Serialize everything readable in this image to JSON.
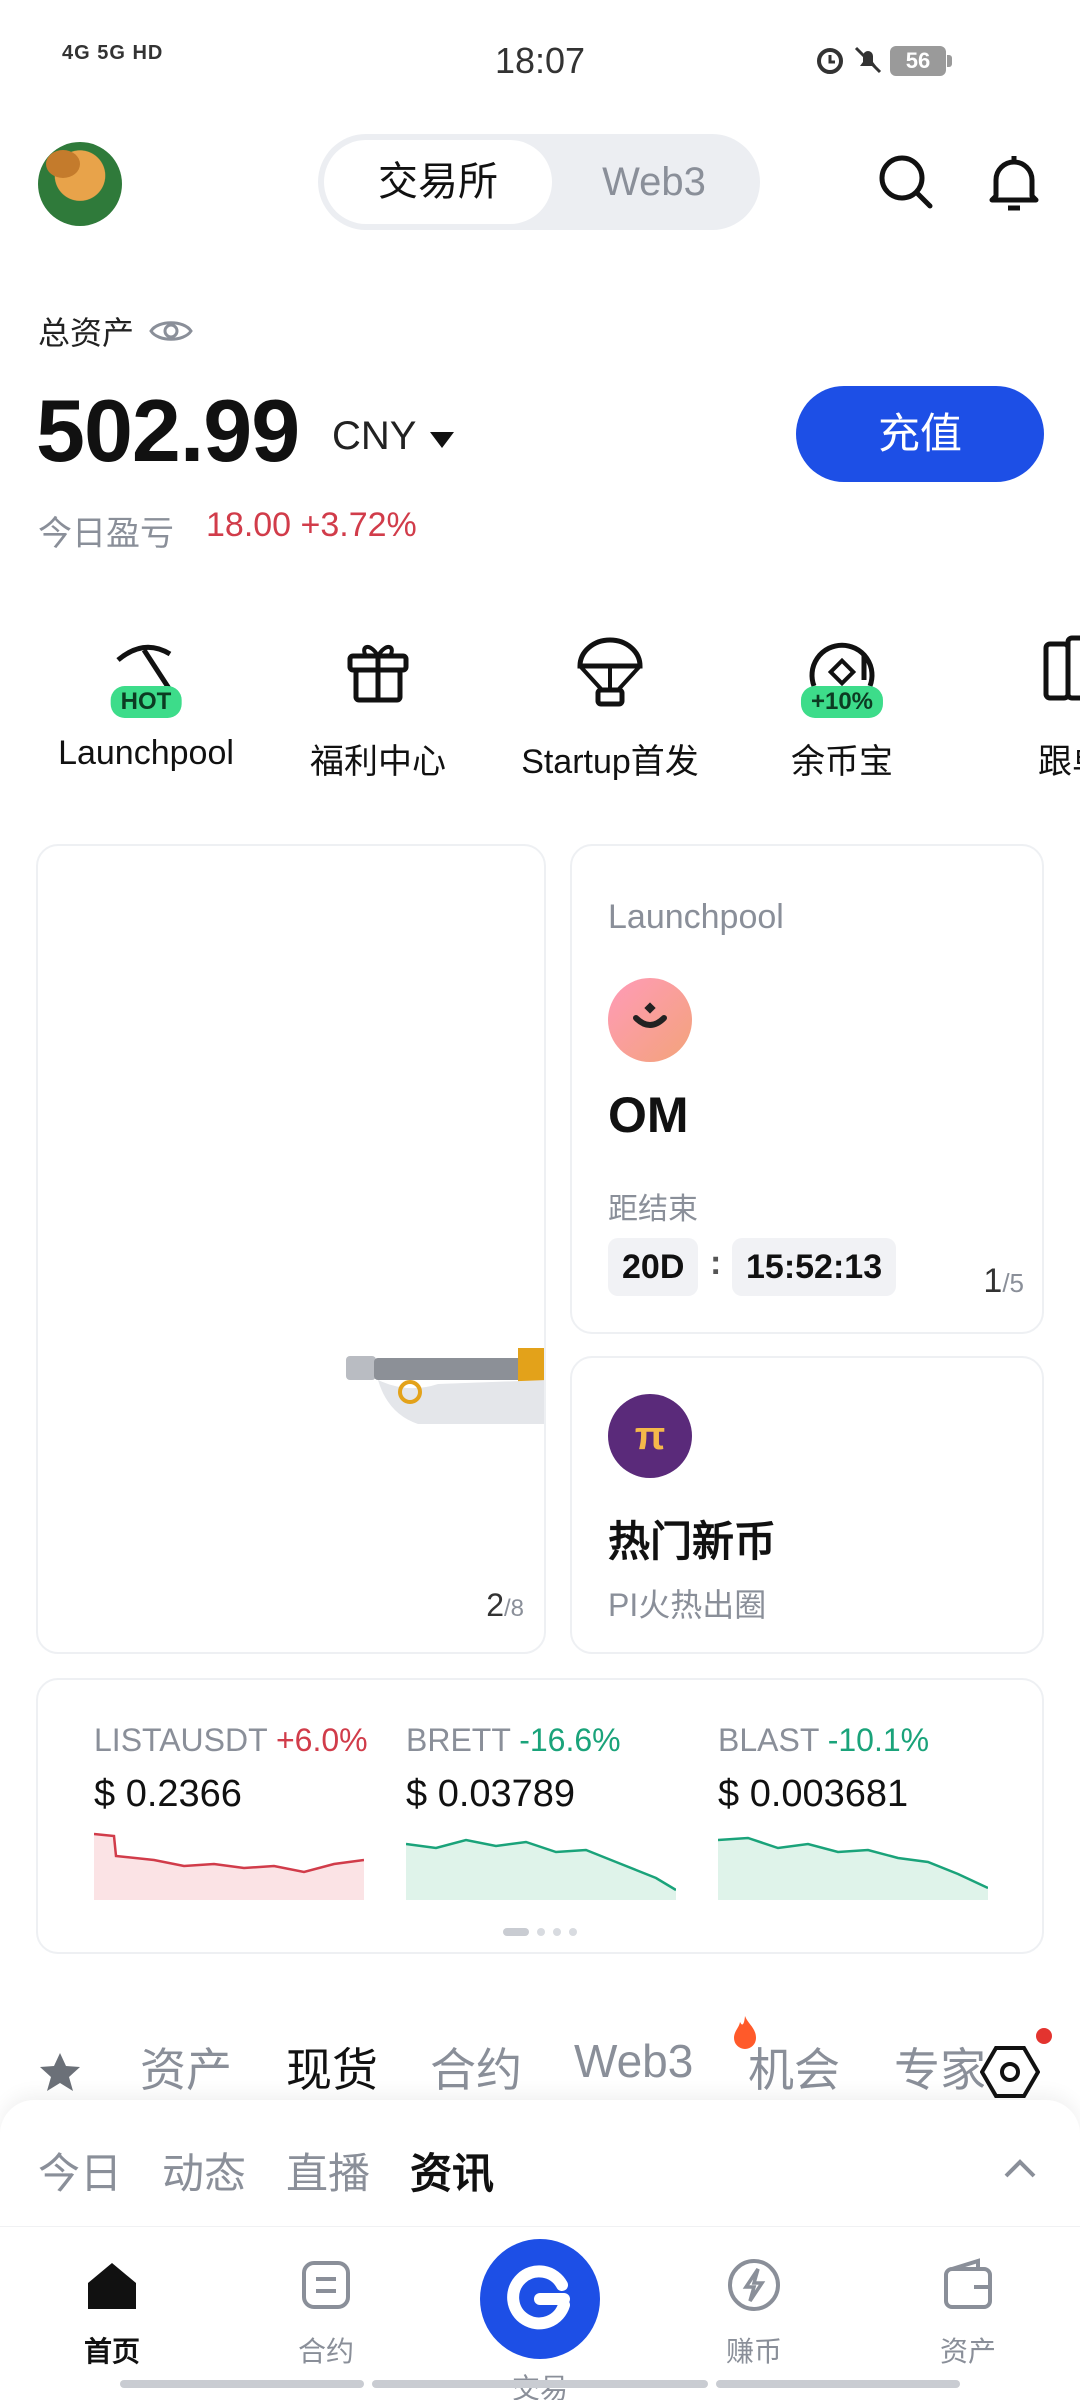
{
  "status_bar": {
    "signal": "4G 5G HD",
    "time": "18:07",
    "battery": "56"
  },
  "header": {
    "tabs": [
      {
        "label": "交易所",
        "active": true
      },
      {
        "label": "Web3",
        "active": false
      }
    ],
    "icons": [
      "search-icon",
      "bell-icon"
    ]
  },
  "assets": {
    "label": "总资产",
    "amount": "502.99",
    "currency": "CNY",
    "deposit_label": "充值",
    "pnl_label": "今日盈亏",
    "pnl_value": "18.00 +3.72%"
  },
  "shortcuts": [
    {
      "label": "Launchpool",
      "icon": "pickaxe-icon",
      "badge": "HOT"
    },
    {
      "label": "福利中心",
      "icon": "gift-icon",
      "badge": ""
    },
    {
      "label": "Startup首发",
      "icon": "parachute-icon",
      "badge": ""
    },
    {
      "label": "余币宝",
      "icon": "savings-icon",
      "badge": "+10%"
    },
    {
      "label": "跟单",
      "icon": "copy-trade-icon",
      "badge": ""
    }
  ],
  "banner": {
    "page": "2",
    "total": "/8"
  },
  "launchpool_card": {
    "title": "Launchpool",
    "coin": "OM",
    "ends_label": "距结束",
    "days": "20D",
    "time": "15:52:13",
    "page": "1",
    "total": "/5"
  },
  "hot_card": {
    "title": "热门新币",
    "subtitle": "PI火热出圈",
    "logo": "π"
  },
  "tickers": [
    {
      "symbol": "LISTAUSDT",
      "change": "+6.0%",
      "direction": "up",
      "price": "$ 0.2366",
      "color": "#d13c4a"
    },
    {
      "symbol": "BRETT",
      "change": "-16.6%",
      "direction": "down",
      "price": "$ 0.03789",
      "color": "#1aa37a"
    },
    {
      "symbol": "BLAST",
      "change": "-10.1%",
      "direction": "down",
      "price": "$ 0.003681",
      "color": "#1aa37a"
    }
  ],
  "market_tabs": [
    {
      "label": "资产",
      "active": false
    },
    {
      "label": "现货",
      "active": true
    },
    {
      "label": "合约",
      "active": false
    },
    {
      "label": "Web3",
      "active": false
    },
    {
      "label": "机会",
      "active": false
    },
    {
      "label": "专家",
      "active": false
    }
  ],
  "news_tabs": [
    {
      "label": "今日",
      "active": false
    },
    {
      "label": "动态",
      "active": false
    },
    {
      "label": "直播",
      "active": false
    },
    {
      "label": "资讯",
      "active": true
    }
  ],
  "bottom_nav": [
    {
      "label": "首页",
      "icon": "home-icon",
      "active": true
    },
    {
      "label": "合约",
      "icon": "contract-icon",
      "active": false
    },
    {
      "label": "交易",
      "icon": "trade-icon",
      "active": false
    },
    {
      "label": "赚币",
      "icon": "earn-icon",
      "active": false
    },
    {
      "label": "资产",
      "icon": "wallet-icon",
      "active": false
    }
  ],
  "colors": {
    "brand": "#1d4fe6",
    "up": "#d13c4a",
    "down": "#1aa37a",
    "badge": "#3ddc8a"
  }
}
